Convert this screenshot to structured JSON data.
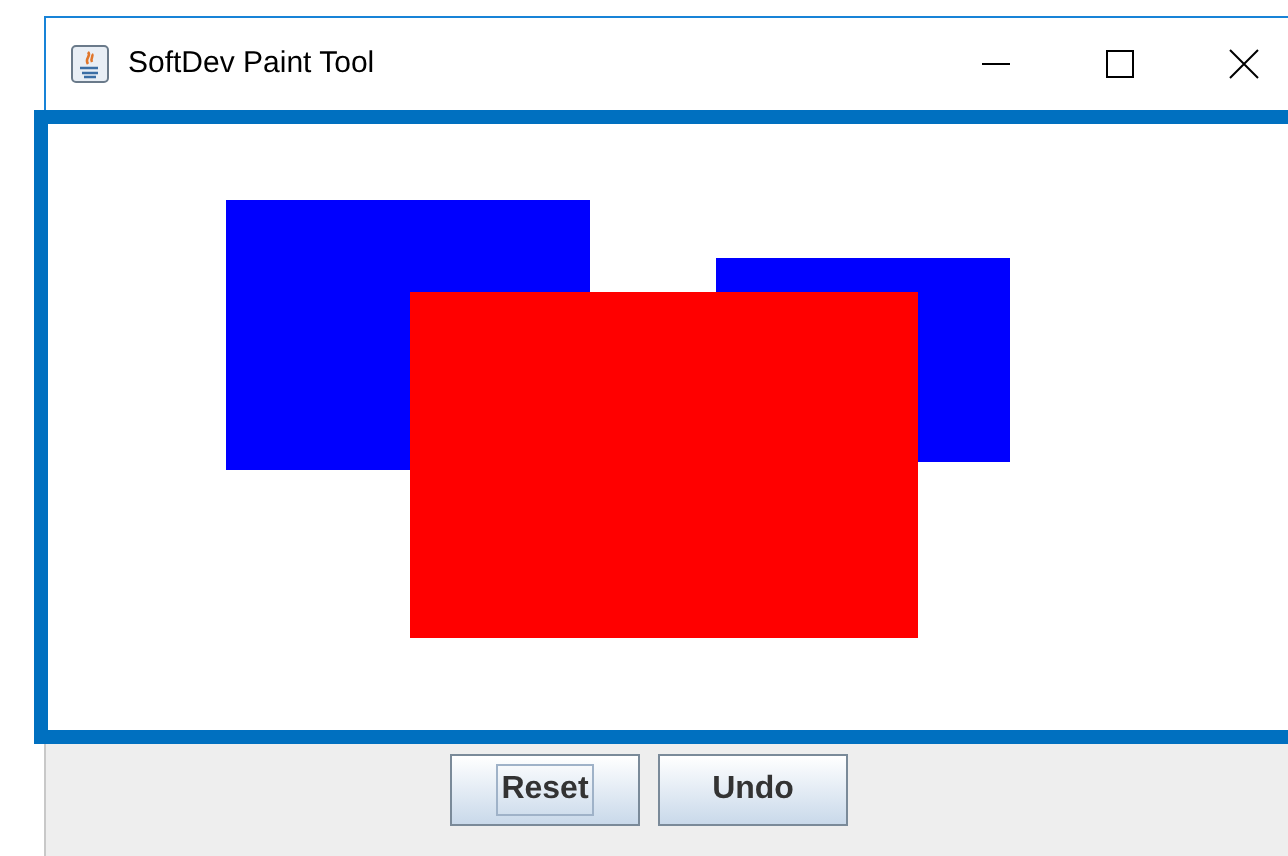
{
  "window": {
    "title": "SoftDev Paint Tool"
  },
  "canvas": {
    "shapes": [
      {
        "kind": "rectangle",
        "color": "#0000ff"
      },
      {
        "kind": "rectangle",
        "color": "#0000ff"
      },
      {
        "kind": "rectangle",
        "color": "#ff0000"
      }
    ]
  },
  "buttons": [
    {
      "label": "Reset",
      "focused": true
    },
    {
      "label": "Undo",
      "focused": false
    }
  ]
}
